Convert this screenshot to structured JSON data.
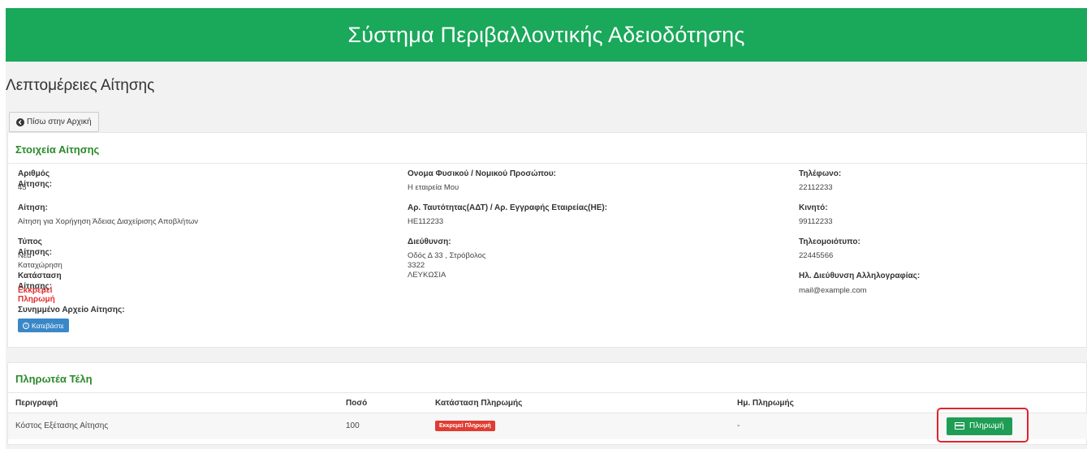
{
  "header": {
    "title": "Σύστημα Περιβαλλοντικής Αδειοδότησης"
  },
  "page": {
    "title": "Λεπτομέρειες Αίτησης",
    "back_label": "Πίσω στην Αρχική"
  },
  "details": {
    "title": "Στοιχεία Αίτησης",
    "application_number": {
      "label": "Αριθμός Αίτησης:",
      "value": "45"
    },
    "application": {
      "label": "Αίτηση:",
      "value": "Αίτηση για Χορήγηση Άδειας Διαχείρισης Αποβλήτων"
    },
    "application_type": {
      "label": "Τύπος Αίτησης:",
      "value": "Νέα Καταχώρηση"
    },
    "application_status": {
      "label": "Κατάσταση Αίτησης:",
      "value": "Εκκρεμεί Πληρωμή"
    },
    "attached_file": {
      "label": "Συνημμένο Αρχείο Αίτησης:",
      "button": "Κατεβάστε"
    },
    "person_name": {
      "label": "Ονομα Φυσικού / Νομικού Προσώπου:",
      "value": "Η εταιρεία Μου"
    },
    "id_number": {
      "label": "Αρ. Ταυτότητας(ΑΔΤ) / Αρ. Εγγραφής Εταιρείας(ΗΕ):",
      "value": "ΗΕ112233"
    },
    "address": {
      "label": "Διεύθυνση:",
      "line1": "Οδός Δ 33 , Στρόβολος",
      "line2": "3322",
      "line3": "ΛΕΥΚΩΣΙΑ"
    },
    "phone": {
      "label": "Τηλέφωνο:",
      "value": "22112233"
    },
    "mobile": {
      "label": "Κινητό:",
      "value": "99112233"
    },
    "fax": {
      "label": "Τηλεομοιότυπο:",
      "value": "22445566"
    },
    "email": {
      "label": "Ηλ. Διεύθυνση Αλληλογραφίας:",
      "value": "mail@example.com"
    }
  },
  "fees": {
    "title": "Πληρωτέα Τέλη",
    "columns": [
      "Περιγραφή",
      "Ποσό",
      "Κατάσταση Πληρωμής",
      "Ημ. Πληρωμής",
      ""
    ],
    "rows": [
      {
        "description": "Κόστος Εξέτασης Αίτησης",
        "amount": "100",
        "status": "Εκκρεμεί Πληρωμή",
        "date": "-",
        "action": "Πληρωμή"
      }
    ]
  },
  "colors": {
    "header": "#1aa85a",
    "title_green": "#2a8a2a",
    "status_red": "#e03030",
    "pay_green": "#1f9d55",
    "download_blue": "#3a87c8"
  }
}
